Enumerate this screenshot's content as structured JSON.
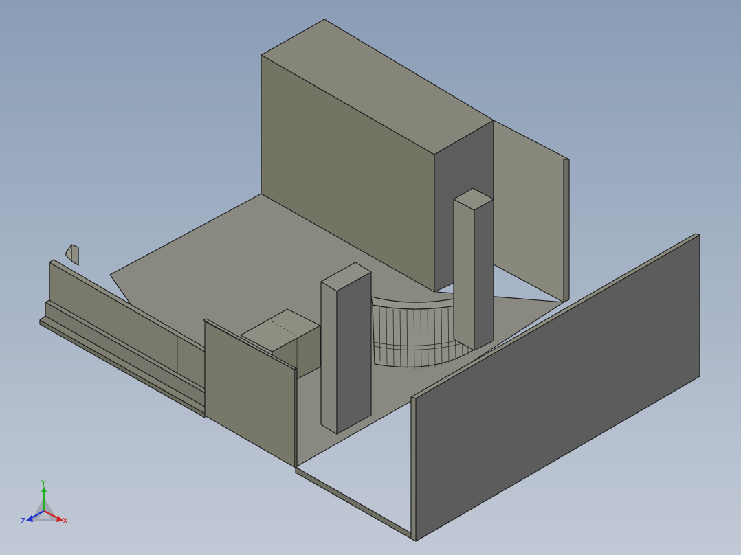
{
  "viewport": {
    "background_top": "#8a9db6",
    "background_bottom": "#c2c9d6"
  },
  "model": {
    "colors": {
      "light_face": "#8b8b7f",
      "mid_face": "#7a7a6c",
      "dark_face": "#5e5e5e",
      "floor": "#898981",
      "edge": "#1f1f1f"
    }
  },
  "triad": {
    "x_label": "X",
    "y_label": "Y",
    "z_label": "Z",
    "x_color": "#d42020",
    "y_color": "#20b020",
    "z_color": "#2030d0"
  }
}
